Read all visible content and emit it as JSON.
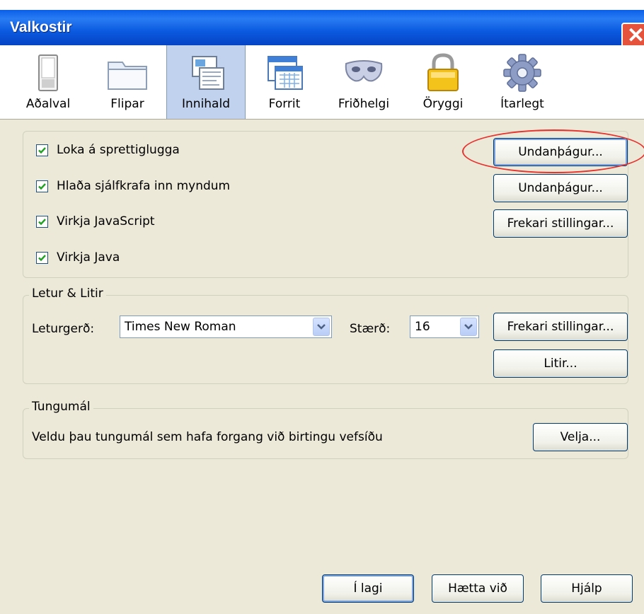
{
  "window": {
    "title": "Valkostir",
    "close_glyph": "✕"
  },
  "toolbar": {
    "tabs": [
      {
        "label": "Aðalval",
        "icon": "switch-icon"
      },
      {
        "label": "Flipar",
        "icon": "folder-tabs-icon"
      },
      {
        "label": "Innihald",
        "icon": "content-icon",
        "selected": true
      },
      {
        "label": "Forrit",
        "icon": "applications-icon"
      },
      {
        "label": "Friðhelgi",
        "icon": "mask-icon"
      },
      {
        "label": "Öryggi",
        "icon": "padlock-icon"
      },
      {
        "label": "Ítarlegt",
        "icon": "gear-icon"
      }
    ]
  },
  "content": {
    "checkboxes": [
      {
        "label": "Loka á sprettiglugga",
        "checked": true
      },
      {
        "label": "Hlaða sjálfkrafa inn myndum",
        "checked": true
      },
      {
        "label": "Virkja JavaScript",
        "checked": true
      },
      {
        "label": "Virkja Java",
        "checked": true
      }
    ],
    "buttons": {
      "popup_exceptions": "Undanþágur...",
      "image_exceptions": "Undanþágur...",
      "js_advanced": "Frekari stillingar..."
    }
  },
  "fonts": {
    "legend": "Letur & Litir",
    "font_label": "Leturgerð:",
    "font_value": "Times New Roman",
    "size_label": "Stærð:",
    "size_value": "16",
    "advanced_button": "Frekari stillingar...",
    "colors_button": "Litir..."
  },
  "languages": {
    "legend": "Tungumál",
    "description": "Veldu þau tungumál sem hafa forgang við birtingu vefsíðu",
    "choose_button": "Velja..."
  },
  "footer": {
    "ok": "Í lagi",
    "cancel": "Hætta við",
    "help": "Hjálp"
  },
  "colors": {
    "titlebar": "#0a5fe8",
    "dialog_bg": "#ece9d8",
    "annotation": "#e8322e"
  }
}
